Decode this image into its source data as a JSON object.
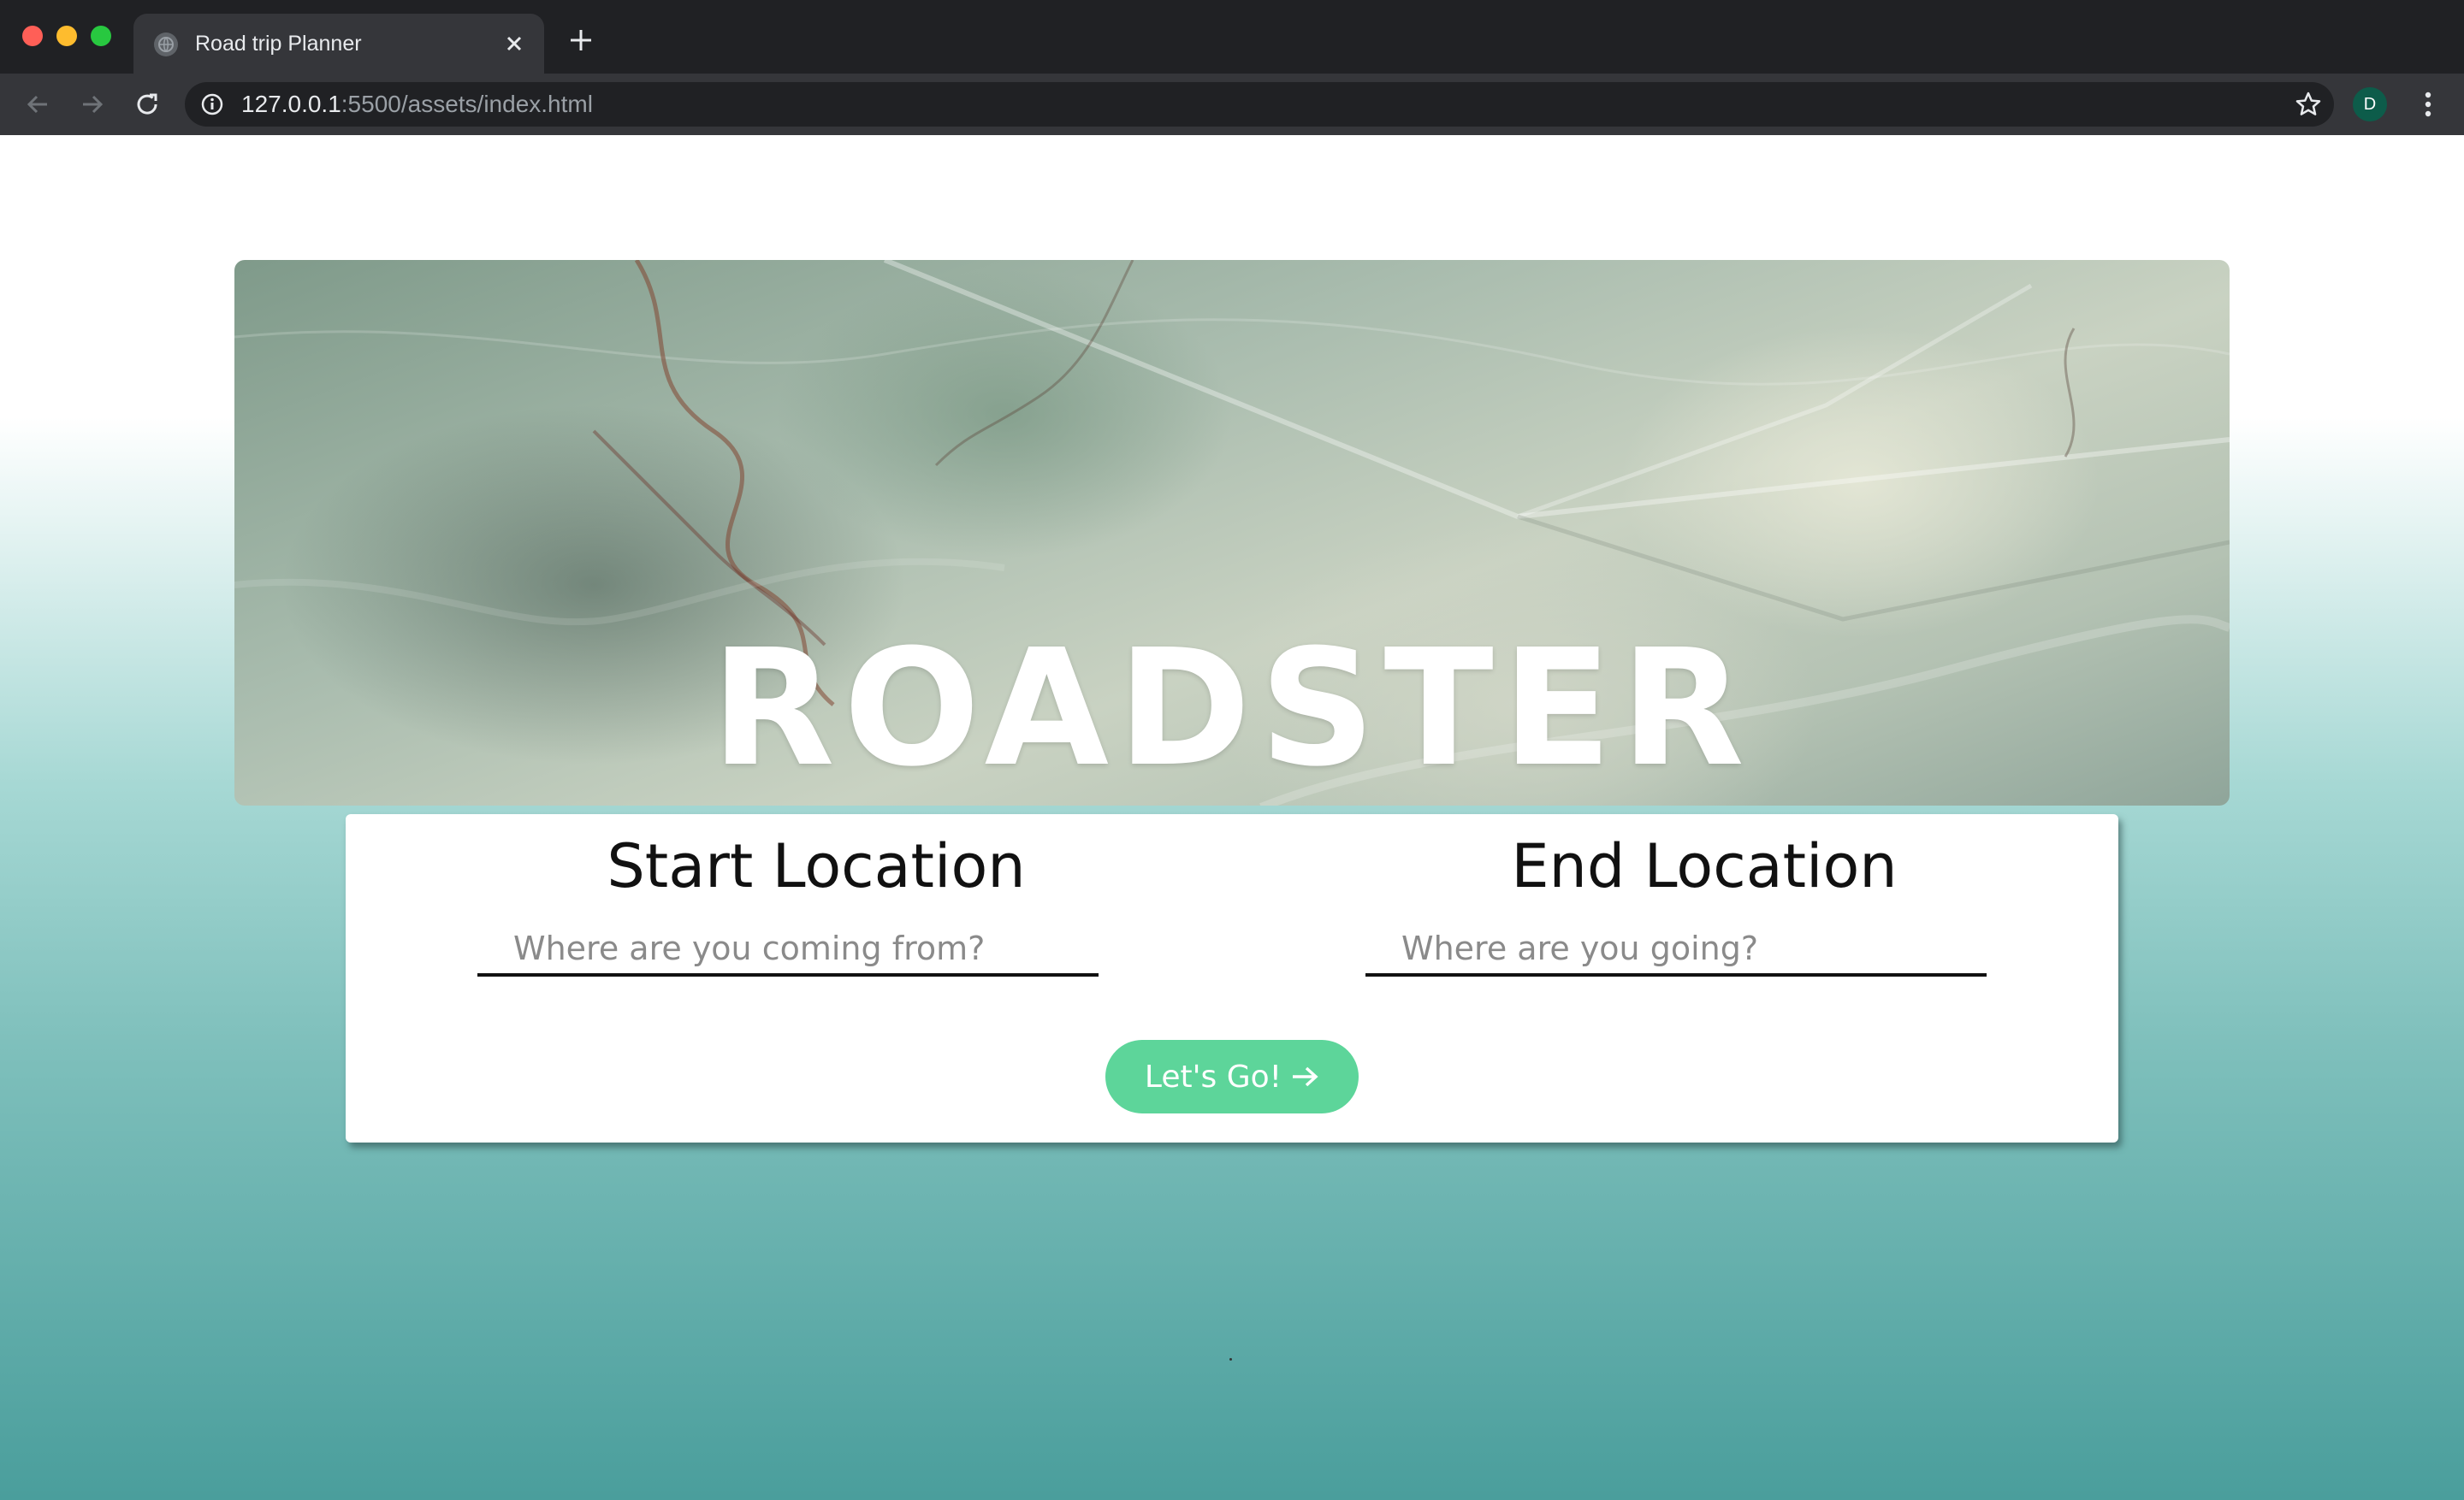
{
  "browser": {
    "tab_title": "Road trip Planner",
    "url_host": "127.0.0.1",
    "url_path": ":5500/assets/index.html",
    "profile_initial": "D"
  },
  "hero": {
    "title": "ROADSTER"
  },
  "form": {
    "start_title": "Start Location",
    "start_placeholder": "Where are you coming from?",
    "end_title": "End Location",
    "end_placeholder": "Where are you going?",
    "go_label": "Let's Go!",
    "go_icon": "arrow-right-icon"
  },
  "colors": {
    "accent": "#5dd59a",
    "background_bottom": "#4a9e9c"
  }
}
